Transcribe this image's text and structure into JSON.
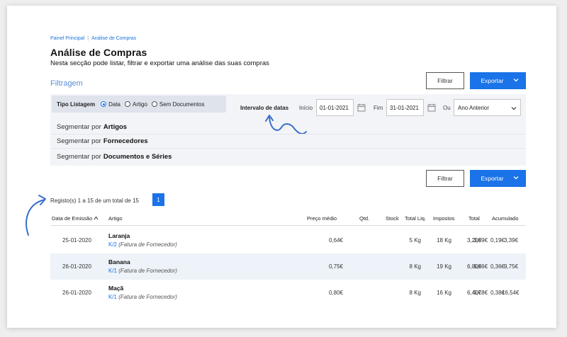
{
  "breadcrumb": [
    "Painel Principal",
    "Análise de Compras"
  ],
  "breadcrumb_sep": "|",
  "title": "Análise de Compras",
  "subtitle": "Nesta secção pode listar, filtrar e exportar uma análise das suas compras",
  "section_title": "Filtragem",
  "buttons": {
    "filter": "Filtrar",
    "export": "Exportar"
  },
  "tipo_listagem": {
    "label": "Tipo Listagem",
    "options": [
      "Data",
      "Artigo",
      "Sem Documentos"
    ],
    "selected": "Data"
  },
  "date_range": {
    "label": "Intervalo de datas",
    "start_label": "Início",
    "start": "01-01-2021",
    "end_label": "Fim",
    "end": "31-01-2021",
    "or_label": "Ou",
    "preset": "Ano Anterior"
  },
  "segments": [
    {
      "prefix": "Segmentar por",
      "bold": "Artigos"
    },
    {
      "prefix": "Segmentar por",
      "bold": "Fornecedores"
    },
    {
      "prefix": "Segmentar por",
      "bold": "Documentos e Séries"
    }
  ],
  "records_text": "Registo(s) 1 a 15 de um total de 15",
  "current_page": "1",
  "columns": [
    "Data de Emissão",
    "Artigo",
    "Preço médio",
    "Qtd.",
    "Stock",
    "Total Liq.",
    "Impostos",
    "Total",
    "Acumulado"
  ],
  "rows": [
    {
      "date": "25-01-2020",
      "article": "Laranja",
      "doc_code": "K/2",
      "doc_desc": "(Fatura de Fornecedor)",
      "price": "0,64€",
      "qty": "5 Kg",
      "stock": "18 Kg",
      "total_liq": "3,20€",
      "taxes": "0,19€",
      "total": "3,39€",
      "accum": "3,39€"
    },
    {
      "date": "26-01-2020",
      "article": "Banana",
      "doc_code": "K/1",
      "doc_desc": "(Fatura de Fornecedor)",
      "price": "0,75€",
      "qty": "8 Kg",
      "stock": "19 Kg",
      "total_liq": "6,00€",
      "taxes": "0,36€",
      "total": "6,36€",
      "accum": "9,75€"
    },
    {
      "date": "26-01-2020",
      "article": "Maçã",
      "doc_code": "K/1",
      "doc_desc": "(Fatura de Fornecedor)",
      "price": "0,80€",
      "qty": "8 Kg",
      "stock": "16 Kg",
      "total_liq": "6,40€",
      "taxes": "0,38€",
      "total": "6,78€",
      "accum": "16,54€"
    }
  ],
  "colors": {
    "accent": "#1a73e8",
    "annotation": "#3b6fc9",
    "row_highlight": "#edf3f8",
    "panel": "#f2f4f8"
  },
  "icons": [
    "calendar-icon",
    "chevron-down-icon",
    "sort-up-icon"
  ]
}
